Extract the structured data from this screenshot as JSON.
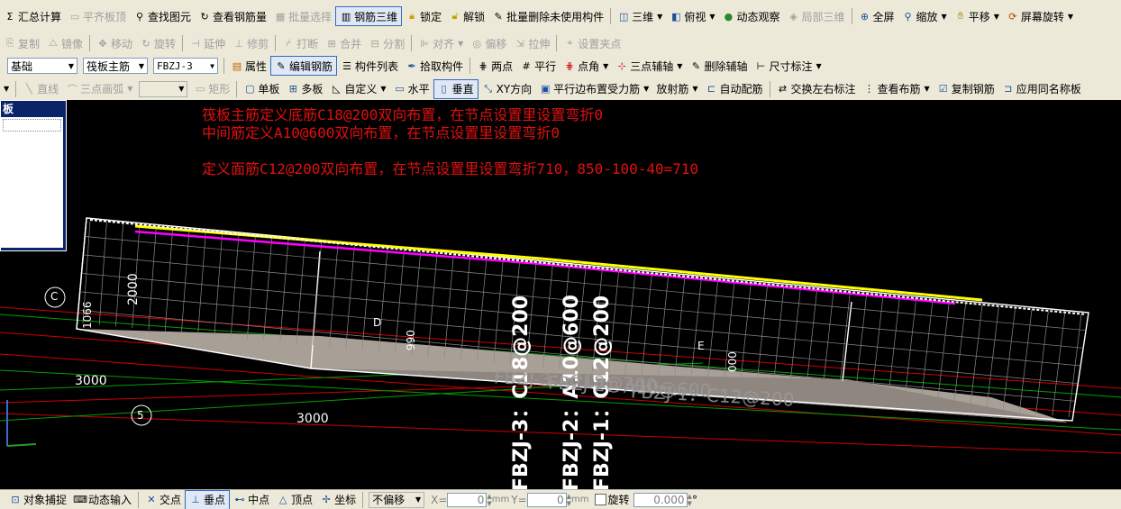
{
  "toolbar1": {
    "items": [
      {
        "label": "汇总计算",
        "icon": "sum-icon",
        "disabled": false
      },
      {
        "label": "平齐板顶",
        "icon": "align-top-icon",
        "disabled": true
      },
      {
        "label": "查找图元",
        "icon": "binoculars-icon",
        "disabled": false
      },
      {
        "label": "查看钢筋量",
        "icon": "view-rebar-icon",
        "disabled": false
      },
      {
        "label": "批量选择",
        "icon": "batch-select-icon",
        "disabled": true
      },
      {
        "label": "钢筋三维",
        "icon": "rebar-3d-icon",
        "disabled": false,
        "active": true
      },
      {
        "label": "锁定",
        "icon": "lock-icon",
        "disabled": false
      },
      {
        "label": "解锁",
        "icon": "unlock-icon",
        "disabled": false
      },
      {
        "label": "批量删除未使用构件",
        "icon": "batch-delete-icon",
        "disabled": false
      },
      {
        "label": "三维",
        "icon": "cube-icon",
        "disabled": false,
        "dropdown": true
      },
      {
        "label": "俯视",
        "icon": "top-view-icon",
        "disabled": false,
        "dropdown": true
      },
      {
        "label": "动态观察",
        "icon": "orbit-icon",
        "disabled": false
      },
      {
        "label": "局部三维",
        "icon": "local-3d-icon",
        "disabled": true
      },
      {
        "label": "全屏",
        "icon": "fullscreen-icon",
        "disabled": false
      },
      {
        "label": "缩放",
        "icon": "zoom-icon",
        "disabled": false,
        "dropdown": true
      },
      {
        "label": "平移",
        "icon": "pan-icon",
        "disabled": false,
        "dropdown": true
      },
      {
        "label": "屏幕旋转",
        "icon": "screen-rotate-icon",
        "disabled": false,
        "dropdown": true
      }
    ]
  },
  "toolbar2": {
    "items": [
      {
        "label": "复制",
        "icon": "copy-icon"
      },
      {
        "label": "镜像",
        "icon": "mirror-icon"
      },
      {
        "label": "移动",
        "icon": "move-icon"
      },
      {
        "label": "旋转",
        "icon": "rotate-icon"
      },
      {
        "label": "延伸",
        "icon": "extend-icon"
      },
      {
        "label": "修剪",
        "icon": "trim-icon"
      },
      {
        "label": "打断",
        "icon": "break-icon"
      },
      {
        "label": "合并",
        "icon": "merge-icon"
      },
      {
        "label": "分割",
        "icon": "split-icon"
      },
      {
        "label": "对齐",
        "icon": "align-icon",
        "dropdown": true
      },
      {
        "label": "偏移",
        "icon": "offset-icon"
      },
      {
        "label": "拉伸",
        "icon": "stretch-icon"
      },
      {
        "label": "设置夹点",
        "icon": "grip-icon"
      }
    ]
  },
  "toolbar3": {
    "layer_select": "基础",
    "type_select": "筏板主筋",
    "name_select": "FBZJ-3",
    "items": [
      {
        "label": "属性",
        "icon": "properties-icon"
      },
      {
        "label": "编辑钢筋",
        "icon": "edit-rebar-icon",
        "active": true
      },
      {
        "label": "构件列表",
        "icon": "list-icon"
      },
      {
        "label": "拾取构件",
        "icon": "pick-icon"
      },
      {
        "label": "两点",
        "icon": "two-point-icon"
      },
      {
        "label": "平行",
        "icon": "parallel-icon"
      },
      {
        "label": "点角",
        "icon": "point-angle-icon",
        "dropdown": true
      },
      {
        "label": "三点辅轴",
        "icon": "three-point-axis-icon",
        "dropdown": true
      },
      {
        "label": "删除辅轴",
        "icon": "delete-axis-icon"
      },
      {
        "label": "尺寸标注",
        "icon": "dimension-icon",
        "dropdown": true
      }
    ]
  },
  "toolbar4": {
    "items": [
      {
        "label": "直线",
        "icon": "line-icon",
        "disabled": true
      },
      {
        "label": "三点画弧",
        "icon": "arc-icon",
        "disabled": true,
        "dropdown": true
      },
      {
        "label": "矩形",
        "icon": "rect-icon",
        "disabled": true
      },
      {
        "label": "单板",
        "icon": "single-slab-icon"
      },
      {
        "label": "多板",
        "icon": "multi-slab-icon"
      },
      {
        "label": "自定义",
        "icon": "custom-icon",
        "dropdown": true
      },
      {
        "label": "水平",
        "icon": "horizontal-icon"
      },
      {
        "label": "垂直",
        "icon": "vertical-icon",
        "active": true
      },
      {
        "label": "XY方向",
        "icon": "xy-icon"
      },
      {
        "label": "平行边布置受力筋",
        "icon": "parallel-edge-icon",
        "dropdown": true
      },
      {
        "label": "放射筋",
        "icon": "radial-icon",
        "dropdown": true
      },
      {
        "label": "自动配筋",
        "icon": "auto-rebar-icon"
      },
      {
        "label": "交换左右标注",
        "icon": "swap-label-icon"
      },
      {
        "label": "查看布筋",
        "icon": "view-layout-icon",
        "dropdown": true
      },
      {
        "label": "复制钢筋",
        "icon": "copy-rebar-icon"
      },
      {
        "label": "应用同名称板",
        "icon": "apply-same-icon"
      }
    ]
  },
  "panel": {
    "title": "板"
  },
  "notes": [
    "筏板主筋定义底筋C18@200双向布置，在节点设置里设置弯折0",
    "中间筋定义A10@600双向布置，在节点设置里设置弯折0",
    "定义面筋C12@200双向布置，在节点设置里设置弯折710，850-100-40=710"
  ],
  "drawing": {
    "axis_labels": [
      "C",
      "5",
      "D",
      "E"
    ],
    "dimensions": [
      "3000",
      "3000",
      "2000",
      "1066",
      "000",
      "990"
    ],
    "rebar_labels": [
      "FBZJ-3：C18@200",
      "FBZJ-2：A10@600",
      "FBZJ-1：C12@200"
    ],
    "rebar_labels_faded": [
      "FBZJ-3：C18@200",
      "FBZJ-2：A10@600",
      "FBZJ-1：C12@200"
    ]
  },
  "statusbar": {
    "items": [
      {
        "label": "对象捕捉",
        "icon": "snap-icon"
      },
      {
        "label": "动态输入",
        "icon": "dynamic-input-icon"
      },
      {
        "label": "交点",
        "icon": "intersection-icon"
      },
      {
        "label": "垂点",
        "icon": "perpendicular-icon",
        "active": true
      },
      {
        "label": "中点",
        "icon": "midpoint-icon"
      },
      {
        "label": "顶点",
        "icon": "vertex-icon"
      },
      {
        "label": "坐标",
        "icon": "coordinate-icon"
      }
    ],
    "offset_mode": "不偏移",
    "x_label": "X=",
    "x_value": "0",
    "y_label": "Y=",
    "y_value": "0",
    "unit": "mm",
    "rotate_label": "旋转",
    "rotate_value": "0.000",
    "degree": "°"
  },
  "colors": {
    "note": "#e01010",
    "viewport": "#000000",
    "toolbar": "#ece9d8",
    "slab_fill": "#a89f97",
    "slab_edge": "#ffffff"
  }
}
